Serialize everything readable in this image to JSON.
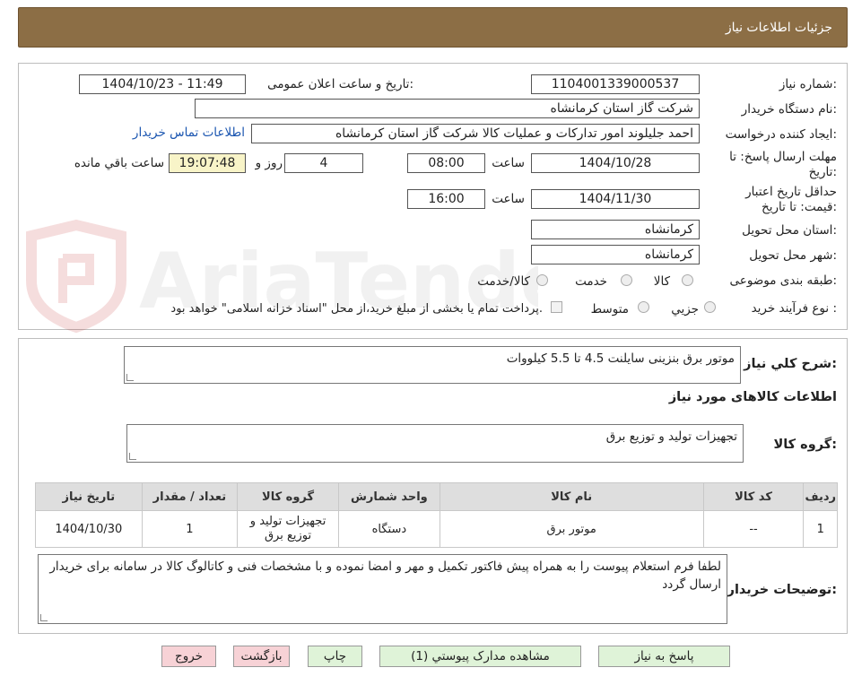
{
  "header": {
    "title": "جزئیات اطلاعات نیاز"
  },
  "form": {
    "need_number": {
      "label": "شماره نیاز:",
      "value": "1104001339000537"
    },
    "announce_datetime": {
      "label": "تاریخ و ساعت اعلان عمومی:",
      "value": "1404/10/23 - 11:49"
    },
    "buyer_org": {
      "label": "نام دستگاه خریدار:",
      "value": "شرکت گاز استان کرمانشاه"
    },
    "creator": {
      "label": "ایجاد کننده درخواست:",
      "value": "احمد جلیلوند امور تدارکات و عملیات کالا شرکت گاز استان کرمانشاه"
    },
    "buyer_contact_link": "اطلاعات تماس خریدار",
    "reply_deadline": {
      "label_line1": "مهلت ارسال پاسخ: تا",
      "label_line2": "تاریخ:",
      "date": "1404/10/28",
      "time_label": "ساعت",
      "time": "08:00",
      "days": "4",
      "days_label": "روز و",
      "remaining": "19:07:48",
      "remaining_label": "ساعت باقي مانده"
    },
    "price_validity": {
      "label_line1": "حداقل تاریخ اعتبار",
      "label_line2": "قیمت: تا تاریخ:",
      "date": "1404/11/30",
      "time_label": "ساعت",
      "time": "16:00"
    },
    "province": {
      "label": "استان محل تحویل:",
      "value": "کرمانشاه"
    },
    "city": {
      "label": "شهر محل تحویل:",
      "value": "کرمانشاه"
    },
    "category": {
      "label": "طبقه بندی موضوعی:",
      "options": [
        "کالا",
        "خدمت",
        "کالا/خدمت"
      ]
    },
    "purchase_process": {
      "label": "نوع فرآیند خرید :",
      "options": [
        "جزیي",
        "متوسط"
      ],
      "payment_note": "پرداخت تمام یا بخشی از مبلغ خرید،از محل \"اسناد خزانه اسلامی\" خواهد بود."
    }
  },
  "summary": {
    "label": "شرح کلي نياز:",
    "value": "موتور برق بنزینی سایلنت 4.5 تا 5.5 کیلووات"
  },
  "goods_section_title": "اطلاعات کالاهای مورد نیاز",
  "goods_group": {
    "label": "گروه کالا:",
    "value": "تجهیزات تولید و توزیع برق"
  },
  "table": {
    "headers": [
      "ردیف",
      "کد کالا",
      "نام کالا",
      "واحد شمارش",
      "گروه کالا",
      "تعداد / مقدار",
      "تاریخ نیاز"
    ],
    "rows": [
      [
        "1",
        "--",
        "موتور برق",
        "دستگاه",
        "تجهیزات تولید و توزیع برق",
        "1",
        "1404/10/30"
      ]
    ]
  },
  "buyer_notes": {
    "label": "توضیحات خریدار:",
    "value": "لطفا   فرم استعلام پیوست  را به همراه پیش فاکتور    تکمیل و مهر و امضا نموده  و با مشخصات فنی و کاتالوگ کالا  در سامانه برای خریدار ارسال گردد"
  },
  "buttons": {
    "reply": "پاسخ به نیاز",
    "attachments": "مشاهده مدارک پیوستي (1)",
    "print": "چاپ",
    "back": "بازگشت",
    "exit": "خروج"
  },
  "watermark": {
    "text": "AriaTender.neT"
  },
  "colors": {
    "header_bg": "#8c6e45",
    "link": "#1a55b0",
    "highlight": "#f8f4c8",
    "btn_green": "#dff3d8",
    "btn_pink": "#f7d2d6"
  }
}
